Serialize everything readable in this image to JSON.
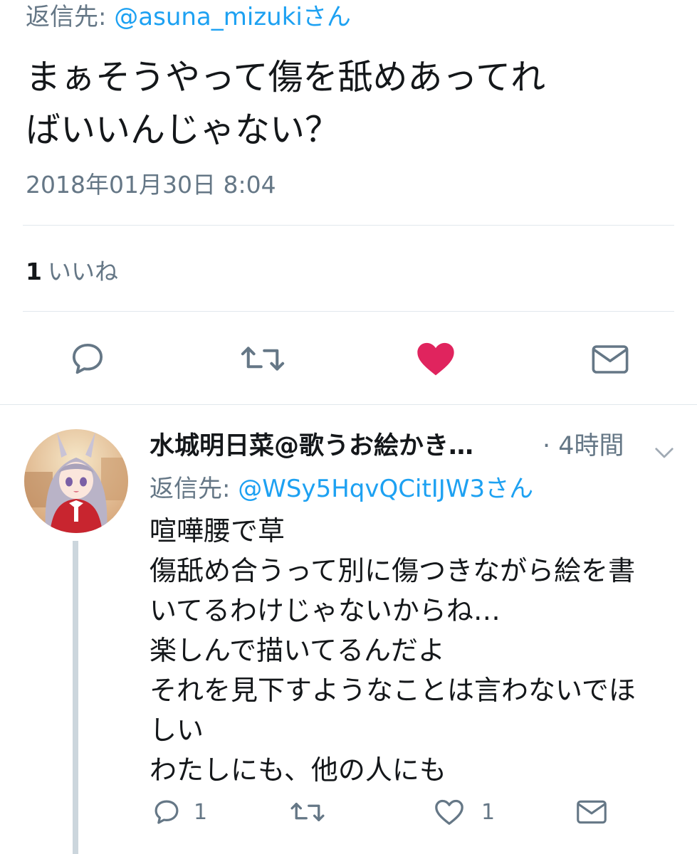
{
  "tweet": {
    "reply_label": "返信先:",
    "reply_handle": "@asuna_mizukiさん",
    "text_lines": [
      "まぁそうやって傷を舐めあってれ",
      "ばいいんじゃない？"
    ],
    "timestamp": "2018年01月30日 8:04",
    "like_count": "1",
    "like_label": "いいね",
    "actions": [
      {
        "name": "reply",
        "icon": "speech-bubble-icon"
      },
      {
        "name": "retweet",
        "icon": "retweet-icon"
      },
      {
        "name": "like",
        "icon": "heart-icon",
        "active": true
      },
      {
        "name": "message",
        "icon": "envelope-icon"
      }
    ]
  },
  "reply": {
    "author_name": "水城明日菜@歌うお絵かき…",
    "time": "· 4時間",
    "reply_label": "返信先:",
    "reply_handle": "@WSy5HqvQCitIJW3さん",
    "body_lines": [
      "喧嘩腰で草",
      "傷舐め合うって別に傷つきながら絵を書",
      "いてるわけじゃないからね…",
      "楽しんで描いてるんだよ",
      "それを見下すようなことは言わないでほ",
      "しい",
      "わたしにも、他の人にも"
    ],
    "reply_count": "1",
    "like_count": "1"
  },
  "colors": {
    "accent_blue": "#1da1f2",
    "like_red": "#e0245e",
    "text_gray": "#657786",
    "icon_gray": "#657786",
    "divider": "#e1e8ed"
  }
}
